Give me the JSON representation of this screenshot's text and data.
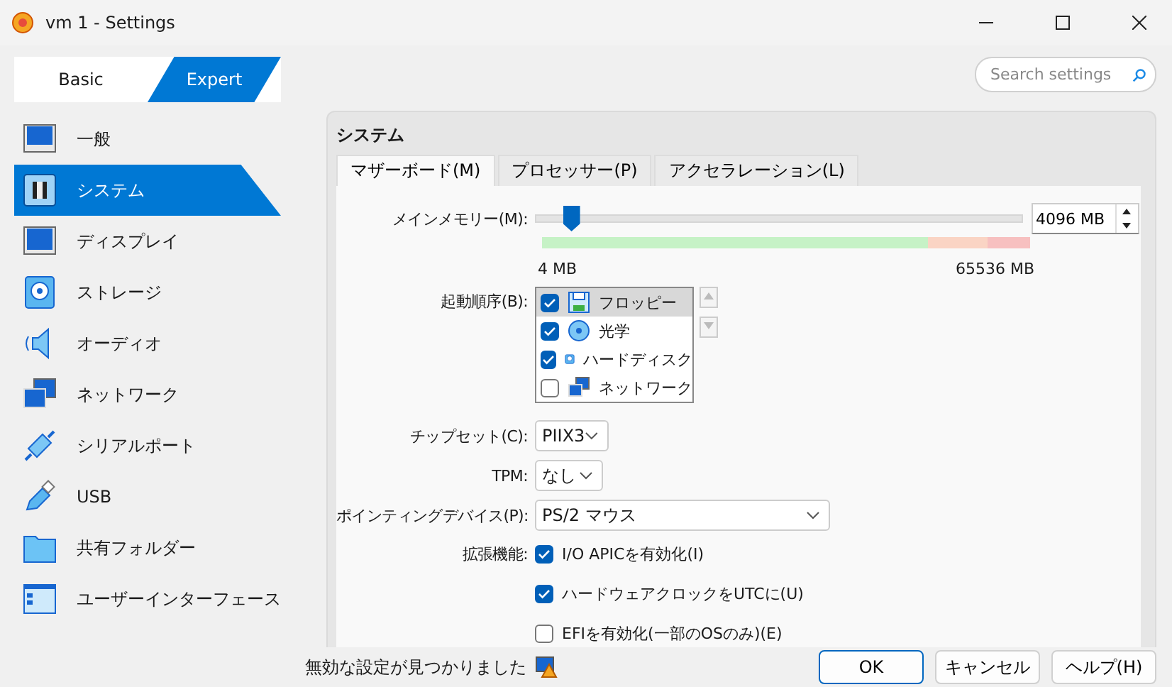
{
  "window": {
    "title": "vm 1 - Settings"
  },
  "mode_tabs": [
    {
      "label": "Basic",
      "selected": false
    },
    {
      "label": "Expert",
      "selected": true
    }
  ],
  "search": {
    "placeholder": "Search settings"
  },
  "sidebar": {
    "items": [
      {
        "label": "一般",
        "kind": "general",
        "selected": false
      },
      {
        "label": "システム",
        "kind": "system",
        "selected": true
      },
      {
        "label": "ディスプレイ",
        "kind": "display",
        "selected": false
      },
      {
        "label": "ストレージ",
        "kind": "storage",
        "selected": false
      },
      {
        "label": "オーディオ",
        "kind": "audio",
        "selected": false
      },
      {
        "label": "ネットワーク",
        "kind": "network",
        "selected": false
      },
      {
        "label": "シリアルポート",
        "kind": "serial",
        "selected": false
      },
      {
        "label": "USB",
        "kind": "usb",
        "selected": false
      },
      {
        "label": "共有フォルダー",
        "kind": "folder",
        "selected": false
      },
      {
        "label": "ユーザーインターフェース",
        "kind": "ui",
        "selected": false
      }
    ]
  },
  "section_title": "システム",
  "tabs": [
    {
      "label": "マザーボード(M)",
      "selected": true
    },
    {
      "label": "プロセッサー(P)",
      "selected": false
    },
    {
      "label": "アクセラレーション(L)",
      "selected": false
    }
  ],
  "memory": {
    "label": "メインメモリー(M):",
    "level": 0.075,
    "min_label": "4 MB",
    "max_label": "65536 MB",
    "value": "4096 MB"
  },
  "boot_order": {
    "label": "起動順序(B):",
    "items": [
      {
        "label": "フロッピー",
        "kind": "floppy",
        "checked": true,
        "selected": true
      },
      {
        "label": "光学",
        "kind": "optical",
        "checked": true,
        "selected": false
      },
      {
        "label": "ハードディスク",
        "kind": "disk",
        "checked": true,
        "selected": false
      },
      {
        "label": "ネットワーク",
        "kind": "network",
        "checked": false,
        "selected": false
      }
    ]
  },
  "chipset": {
    "label": "チップセット(C):",
    "value": "PIIX3"
  },
  "tpm": {
    "label": "TPM:",
    "value": "なし"
  },
  "pointing": {
    "label": "ポインティングデバイス(P):",
    "value": "PS/2 マウス"
  },
  "extended": {
    "label": "拡張機能:",
    "options": [
      {
        "label": "I/O APICを有効化(I)",
        "checked": true
      },
      {
        "label": "ハードウェアクロックをUTCに(U)",
        "checked": true
      },
      {
        "label": "EFIを有効化(一部のOSのみ)(E)",
        "checked": false
      }
    ]
  },
  "status": {
    "text": "無効な設定が見つかりました"
  },
  "buttons": [
    {
      "label": "OK",
      "default": true
    },
    {
      "label": "キャンセル",
      "default": false
    },
    {
      "label": "ヘルプ(H)",
      "default": false
    }
  ]
}
